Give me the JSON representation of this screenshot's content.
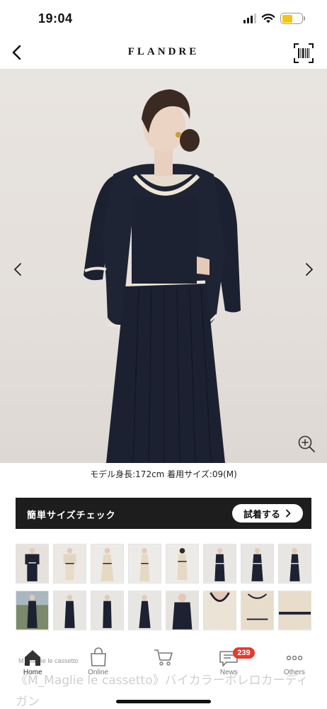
{
  "status_bar": {
    "time": "19:04",
    "battery_level": 0.55,
    "battery_color": "#f5c70a"
  },
  "header": {
    "brand": "FLANDRE",
    "back_icon": "chevron-left-icon",
    "barcode_icon": "barcode-scan-icon"
  },
  "hero": {
    "prev_icon": "chevron-left-icon",
    "next_icon": "chevron-right-icon",
    "zoom_icon": "zoom-in-icon"
  },
  "caption": "モデル身長:172cm 着用サイズ:09(M)",
  "size_check": {
    "label": "簡単サイズチェック",
    "try_on_label": "試着する",
    "try_on_icon": "arrow-right-icon"
  },
  "thumbnails": {
    "row1": [
      "navy-cardigan-set",
      "ivory-set-front",
      "ivory-set-walk",
      "ivory-set-side",
      "ivory-set-back",
      "navy-set-front",
      "navy-set-walk",
      "navy-set-side"
    ],
    "row2": [
      "navy-street",
      "navy-front-2",
      "navy-front-3",
      "navy-side-2",
      "navy-detail",
      "ivory-neck-detail",
      "ivory-cardigan-detail",
      "ivory-trim-detail"
    ]
  },
  "product": {
    "brand": "M_Maglie le cassetto",
    "title": "《M_Maglie le cassetto》バイカラーボレロカーディガン"
  },
  "tab_bar": [
    {
      "label": "Home",
      "icon": "home-icon",
      "active": true
    },
    {
      "label": "Online",
      "icon": "shopping-bag-icon",
      "active": false
    },
    {
      "label": "",
      "icon": "cart-icon",
      "active": false
    },
    {
      "label": "News",
      "icon": "news-icon",
      "active": false,
      "badge": "239"
    },
    {
      "label": "Others",
      "icon": "more-dots-icon",
      "active": false
    }
  ]
}
